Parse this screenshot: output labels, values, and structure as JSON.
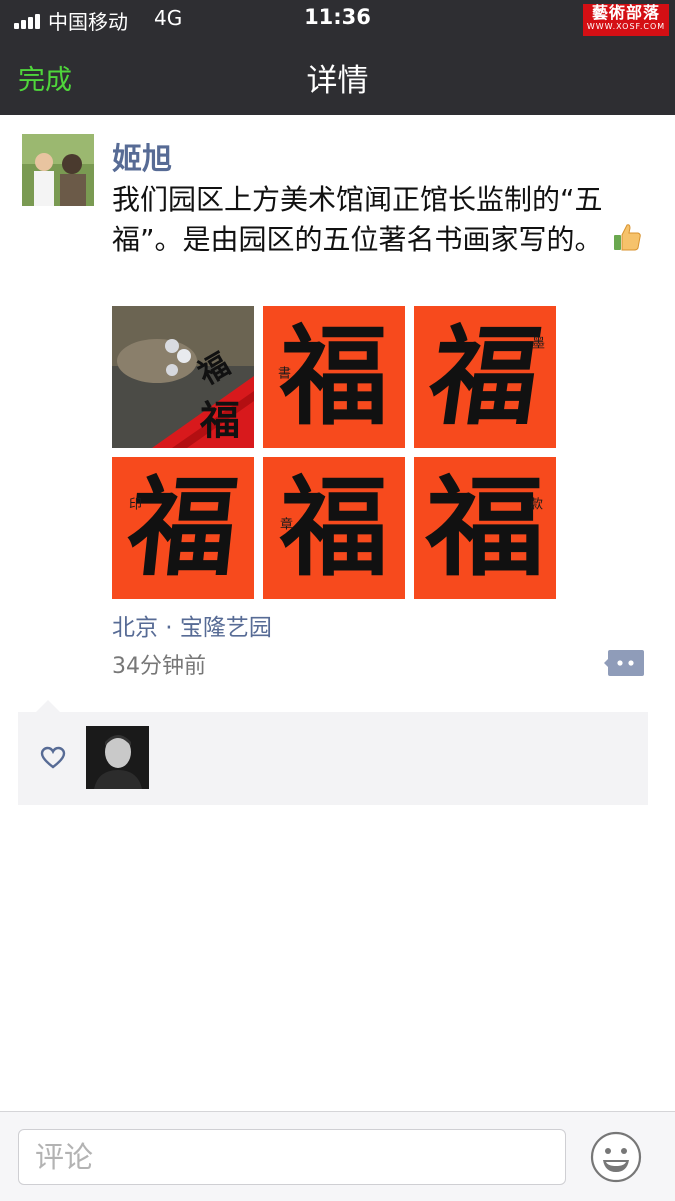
{
  "status_bar": {
    "carrier": "中国移动",
    "network": "4G",
    "time": "11:36",
    "watermark_title": "藝術部落",
    "watermark_url": "WWW.XOSF.COM"
  },
  "nav": {
    "done_label": "完成",
    "title": "详情"
  },
  "post": {
    "author": "姬旭",
    "text": "我们园区上方美术馆闻正馆长监制的“五福”。是由园区的五位著名书画家写的。",
    "location": "北京 · 宝隆艺园",
    "time_ago": "34分钟前",
    "image_glyph": "福"
  },
  "comment_bar": {
    "placeholder": "评论"
  },
  "colors": {
    "link": "#576b95",
    "done_green": "#4fd63b",
    "paper_red": "#f74a1d",
    "topbar": "#2e2e32"
  }
}
